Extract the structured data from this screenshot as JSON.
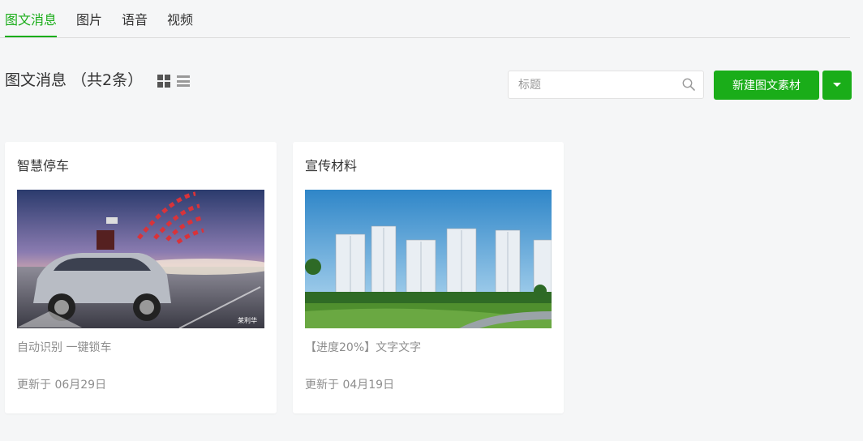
{
  "tabs": [
    {
      "label": "图文消息"
    },
    {
      "label": "图片"
    },
    {
      "label": "语音"
    },
    {
      "label": "视频"
    }
  ],
  "header": {
    "title": "图文消息 （共2条）"
  },
  "search": {
    "placeholder": "标题",
    "value": ""
  },
  "toolbar": {
    "new_label": "新建图文素材"
  },
  "cards": [
    {
      "title": "智慧停车",
      "desc": "自动识别 一键锁车",
      "date": "更新于 06月29日",
      "watermark": "莱利华"
    },
    {
      "title": "宣传材料",
      "desc": "【进度20%】文字文字",
      "date": "更新于 04月19日"
    }
  ],
  "colors": {
    "accent": "#1aad19",
    "background": "#f5f6f7"
  }
}
